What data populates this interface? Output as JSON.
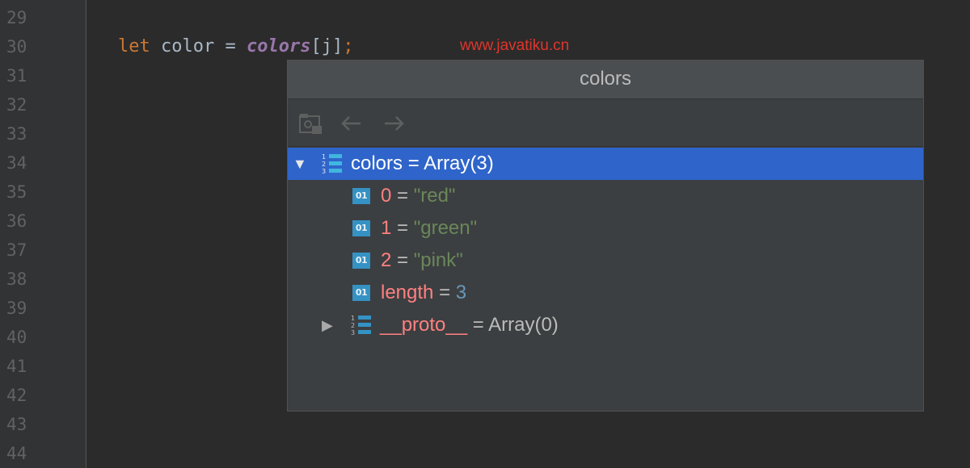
{
  "editor": {
    "line_numbers": [
      "29",
      "30",
      "31",
      "32",
      "33",
      "34",
      "35",
      "36",
      "37",
      "38",
      "39",
      "40",
      "41",
      "42",
      "43",
      "44"
    ],
    "code": {
      "keyword": "let",
      "identifier": "color",
      "operator": "=",
      "variable": "colors",
      "index": "[j]",
      "semicolon": ";"
    },
    "watermark": "www.javatiku.cn"
  },
  "popup": {
    "title": "colors",
    "toolbar": {
      "icons": [
        "watch-icon",
        "back-arrow-icon",
        "forward-arrow-icon"
      ]
    },
    "tree": {
      "root": {
        "name": "colors",
        "equals": "=",
        "value": "Array(3)",
        "expanded": true,
        "icon": "array-icon"
      },
      "items": [
        {
          "name": "0",
          "equals": "=",
          "value": "\"red\"",
          "kind": "string",
          "icon_text": "01"
        },
        {
          "name": "1",
          "equals": "=",
          "value": "\"green\"",
          "kind": "string",
          "icon_text": "01"
        },
        {
          "name": "2",
          "equals": "=",
          "value": "\"pink\"",
          "kind": "string",
          "icon_text": "01"
        },
        {
          "name": "length",
          "equals": "=",
          "value": "3",
          "kind": "number",
          "icon_text": "01"
        }
      ],
      "proto": {
        "name": "__proto__",
        "equals": "=",
        "value": "Array(0)",
        "expanded": false,
        "icon": "array-icon"
      }
    }
  },
  "colors": {
    "selection": "#2f65ca",
    "string": "#6a8759",
    "number": "#6897bb",
    "property": "#ff8080"
  }
}
